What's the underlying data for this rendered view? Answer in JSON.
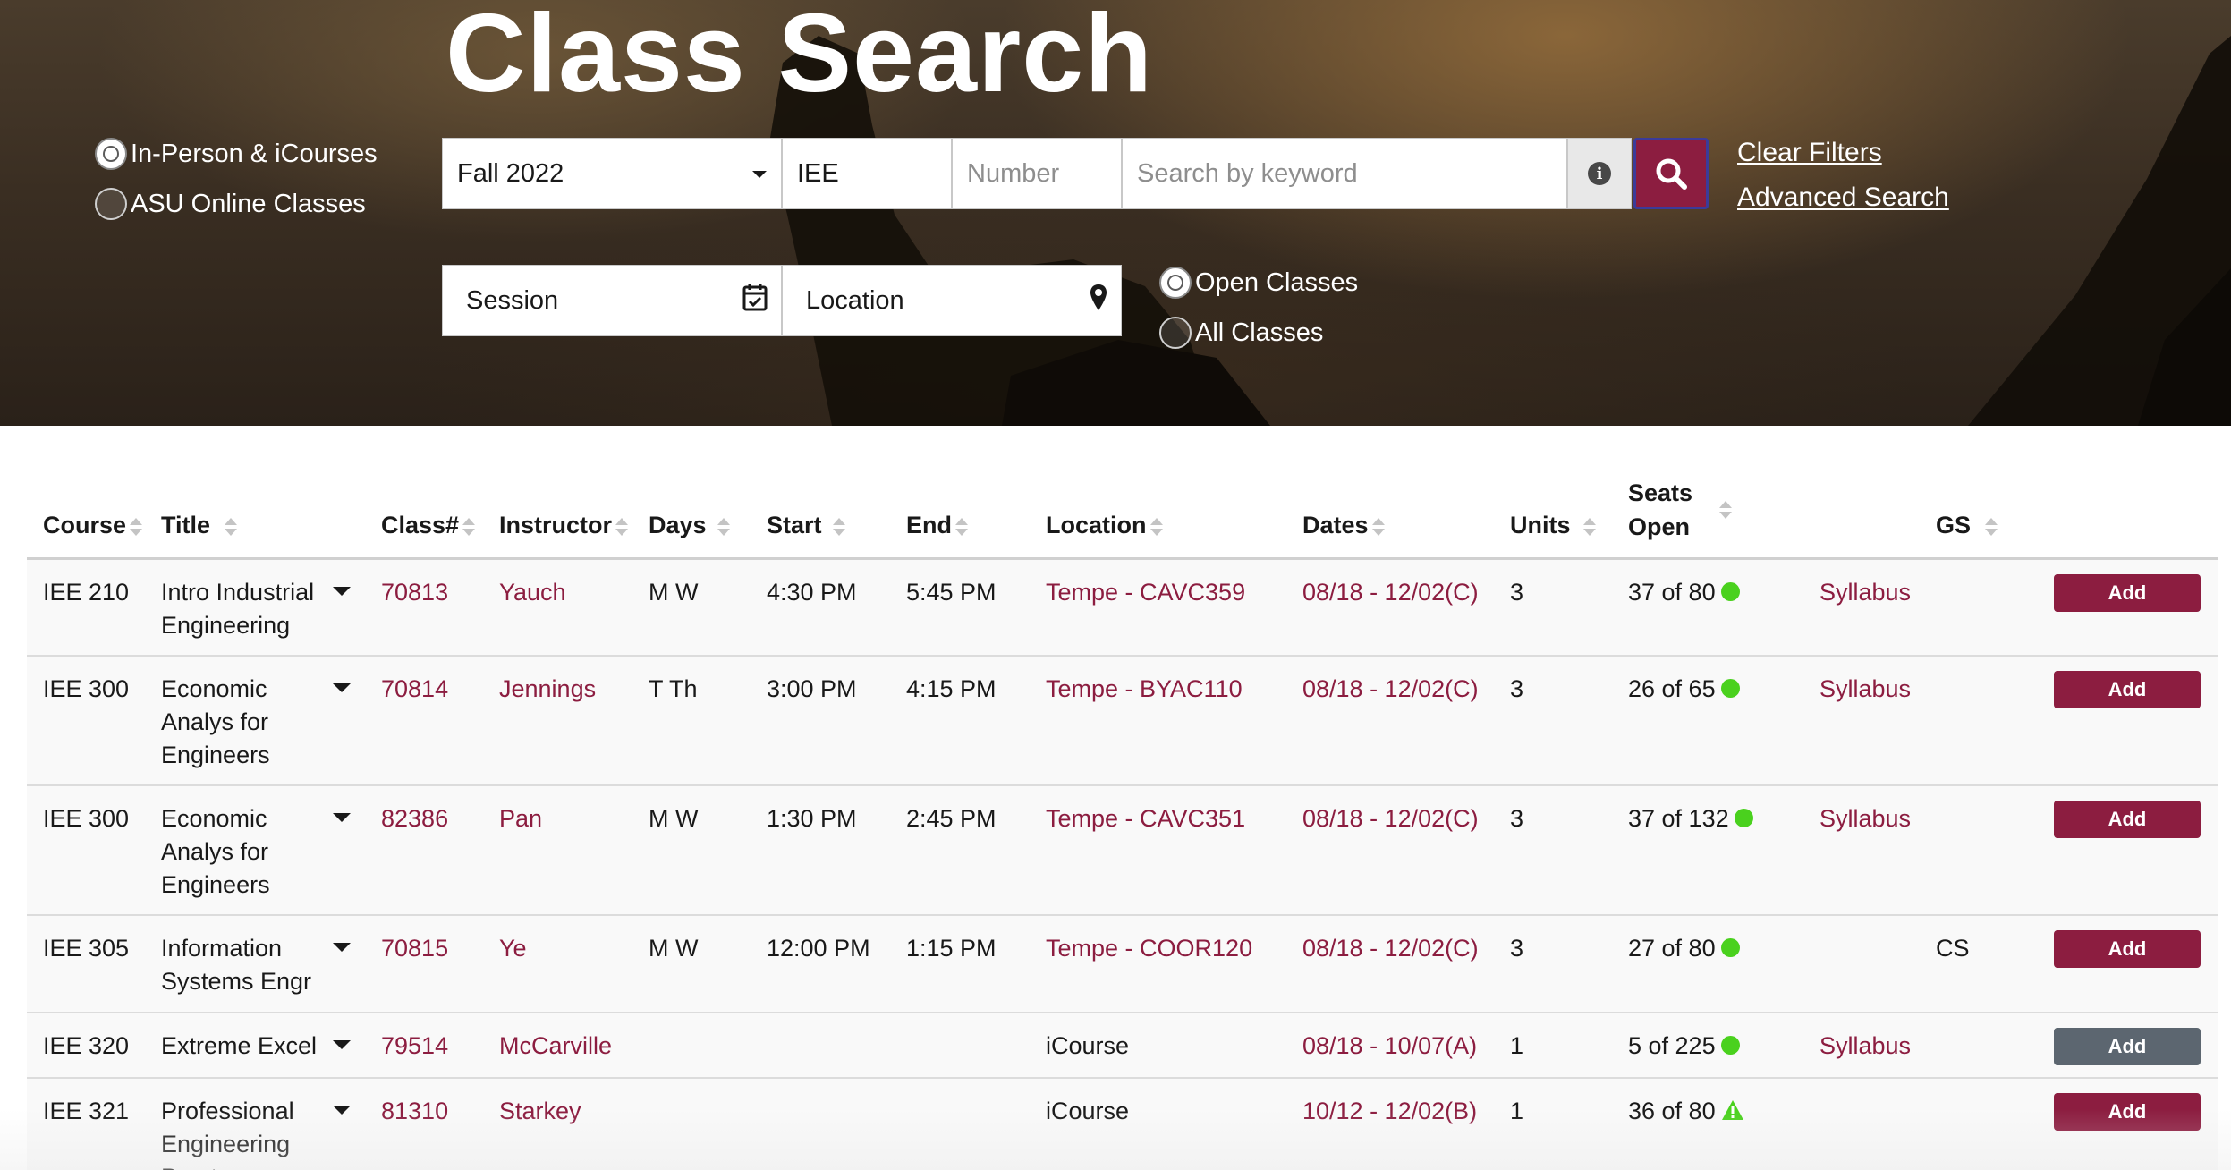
{
  "hero": {
    "title": "Class Search",
    "class_type": [
      "In-Person & iCourses",
      "ASU Online Classes"
    ],
    "term": "Fall 2022",
    "subject": "IEE",
    "number_placeholder": "Number",
    "keyword_placeholder": "Search by keyword",
    "session": "Session",
    "location": "Location",
    "open_filter": [
      "Open Classes",
      "All Classes"
    ],
    "links": {
      "clear": "Clear Filters",
      "advanced": "Advanced Search"
    },
    "icons": {
      "search": "search-icon",
      "info": "info-icon",
      "session": "calendar-icon",
      "location": "map-pin-icon"
    }
  },
  "table": {
    "headers": {
      "course": "Course",
      "title": "Title",
      "class_num": "Class#",
      "instructor": "Instructor",
      "days": "Days",
      "start": "Start",
      "end": "End",
      "location": "Location",
      "dates": "Dates",
      "units": "Units",
      "seats_1": "Seats",
      "seats_2": "Open",
      "gs": "GS"
    },
    "add_label": "Add",
    "rows": [
      {
        "course": "IEE 210",
        "title": "Intro Industrial Engineering",
        "class_num": "70813",
        "instructor": "Yauch",
        "days": "M W",
        "start": "4:30 PM",
        "end": "5:45 PM",
        "location": "Tempe - CAVC359",
        "dates": "08/18 - 12/02(C)",
        "units": "3",
        "seats": "37 of 80",
        "syllabus": "Syllabus",
        "gs": ""
      },
      {
        "course": "IEE 300",
        "title": "Economic Analys for Engineers",
        "class_num": "70814",
        "instructor": "Jennings",
        "days": "T Th",
        "start": "3:00 PM",
        "end": "4:15 PM",
        "location": "Tempe - BYAC110",
        "dates": "08/18 - 12/02(C)",
        "units": "3",
        "seats": "26 of 65",
        "syllabus": "Syllabus",
        "gs": ""
      },
      {
        "course": "IEE 300",
        "title": "Economic Analys for Engineers",
        "class_num": "82386",
        "instructor": "Pan",
        "days": "M W",
        "start": "1:30 PM",
        "end": "2:45 PM",
        "location": "Tempe - CAVC351",
        "dates": "08/18 - 12/02(C)",
        "units": "3",
        "seats": "37 of 132",
        "syllabus": "Syllabus",
        "gs": ""
      },
      {
        "course": "IEE 305",
        "title": "Information Systems Engr",
        "class_num": "70815",
        "instructor": "Ye",
        "days": "M W",
        "start": "12:00 PM",
        "end": "1:15 PM",
        "location": "Tempe - COOR120",
        "dates": "08/18 - 12/02(C)",
        "units": "3",
        "seats": "27 of 80",
        "syllabus": "",
        "gs": "CS"
      },
      {
        "course": "IEE 320",
        "title": "Extreme Excel",
        "class_num": "79514",
        "instructor": "McCarville",
        "days": "",
        "start": "",
        "end": "",
        "location": "iCourse",
        "dates": "08/18 - 10/07(A)",
        "units": "1",
        "seats": "5 of 225",
        "syllabus": "Syllabus",
        "gs": ""
      },
      {
        "course": "IEE 321",
        "title": "Professional Engineering Pract",
        "class_num": "81310",
        "instructor": "Starkey",
        "days": "",
        "start": "",
        "end": "",
        "location": "iCourse",
        "dates": "10/12 - 12/02(B)",
        "units": "1",
        "seats": "36 of 80",
        "syllabus": "",
        "gs": ""
      }
    ]
  },
  "colors": {
    "maroon": "#8c1d40",
    "seat_green": "#4ad11e",
    "disabled_button": "#5c6670"
  }
}
